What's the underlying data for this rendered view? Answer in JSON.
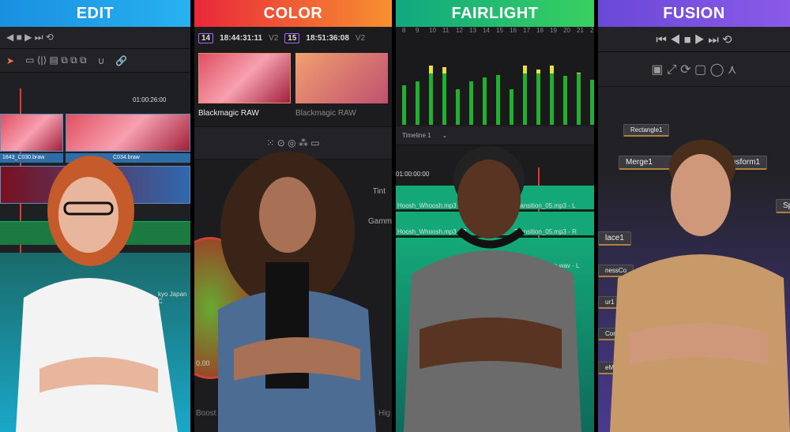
{
  "panels": {
    "edit": {
      "title": "EDIT",
      "accent": "#1ea2ea",
      "timecode": "01:00:26:00",
      "clips": [
        "1843_C030.braw",
        "C034.braw"
      ],
      "tail": "kyo Japan C"
    },
    "color": {
      "title": "COLOR",
      "accent": "#f0442a",
      "clip1": {
        "num": "14",
        "tc": "18:44:31:11",
        "track": "V2",
        "label": "Blackmagic RAW"
      },
      "clip2": {
        "num": "15",
        "tc": "18:51:36:08",
        "track": "V2",
        "label": "Blackmagic RAW"
      },
      "tint": "Tint",
      "gamma": "Gamm",
      "value": "0.00",
      "boost": "Boost",
      "high": "Hig"
    },
    "fairlight": {
      "title": "FAIRLIGHT",
      "accent": "#10b87a",
      "channels": [
        "8",
        "9",
        "10",
        "11",
        "12",
        "13",
        "14",
        "15",
        "16",
        "17",
        "18",
        "19",
        "20",
        "21",
        "2"
      ],
      "levels": [
        0.5,
        0.55,
        0.75,
        0.73,
        0.45,
        0.55,
        0.6,
        0.63,
        0.45,
        0.75,
        0.7,
        0.75,
        0.62,
        0.66,
        0.57
      ],
      "timeline": "Timeline 1",
      "timecode": "01:00:00:00",
      "tracks": [
        "Hoosh_Whoosh.mp3 - L",
        "Transition_05.mp3 - L",
        "Hoosh_Whoosh.mp3 - R",
        "Transition_05.mp3 - R",
        "e.wav - L"
      ]
    },
    "fusion": {
      "title": "FUSION",
      "accent": "#7a4ae0",
      "nodes": [
        "Rectangle1",
        "Merge1",
        "nsform1",
        "Spl",
        "lace1",
        "nessCo",
        "ur1",
        "Corre",
        "eMa"
      ]
    }
  }
}
